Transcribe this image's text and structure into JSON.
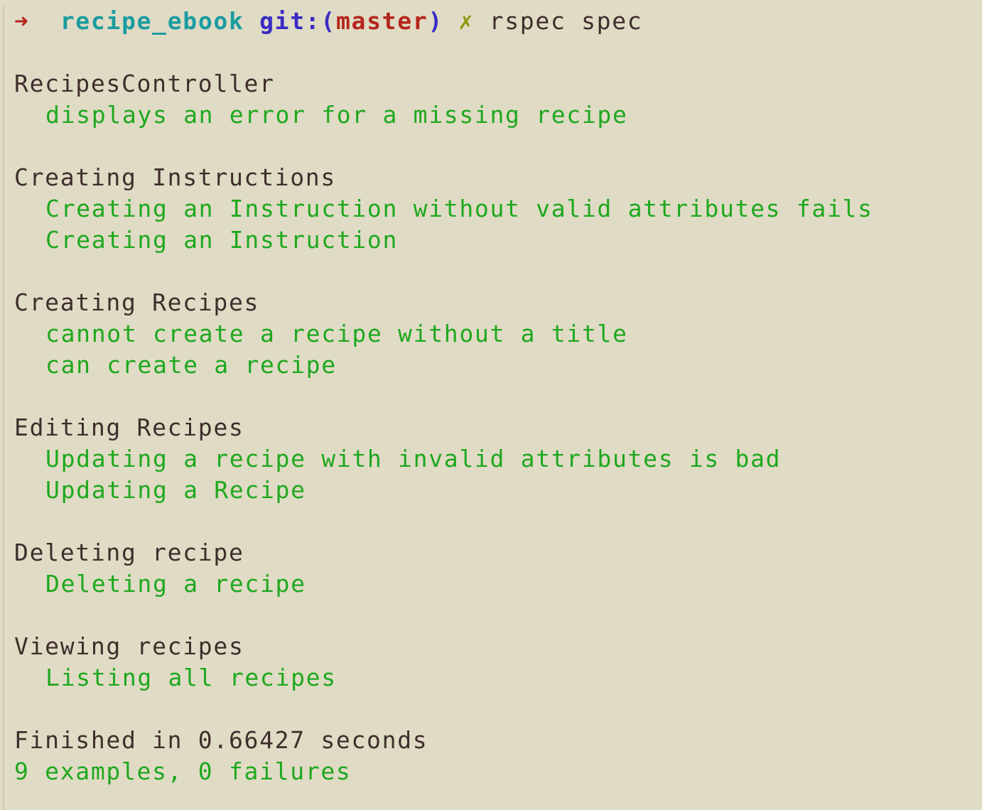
{
  "prompt": {
    "arrow": "➜",
    "directory": "recipe_ebook",
    "git_label": "git:(",
    "branch": "master",
    "git_close": ")",
    "dirty_mark": "✗",
    "command": "rspec spec"
  },
  "groups": [
    {
      "title": "RecipesController",
      "examples": [
        "displays an error for a missing recipe"
      ]
    },
    {
      "title": "Creating Instructions",
      "examples": [
        "Creating an Instruction without valid attributes fails",
        "Creating an Instruction"
      ]
    },
    {
      "title": "Creating Recipes",
      "examples": [
        "cannot create a recipe without a title",
        "can create a recipe"
      ]
    },
    {
      "title": "Editing Recipes",
      "examples": [
        "Updating a recipe with invalid attributes is bad",
        "Updating a Recipe"
      ]
    },
    {
      "title": "Deleting recipe",
      "examples": [
        "Deleting a recipe"
      ]
    },
    {
      "title": "Viewing recipes",
      "examples": [
        "Listing all recipes"
      ]
    }
  ],
  "finished_text": "Finished in 0.66427 seconds",
  "summary_text": "9 examples, 0 failures",
  "colors": {
    "background": "#e0dbc5",
    "pass_green": "#1ea81e",
    "text_dark": "#3f2e2c",
    "arrow_red": "#b4271d",
    "dir_cyan": "#1b9c9f",
    "git_blue": "#3a2bc4",
    "dirty_olive": "#8a9a0e"
  }
}
